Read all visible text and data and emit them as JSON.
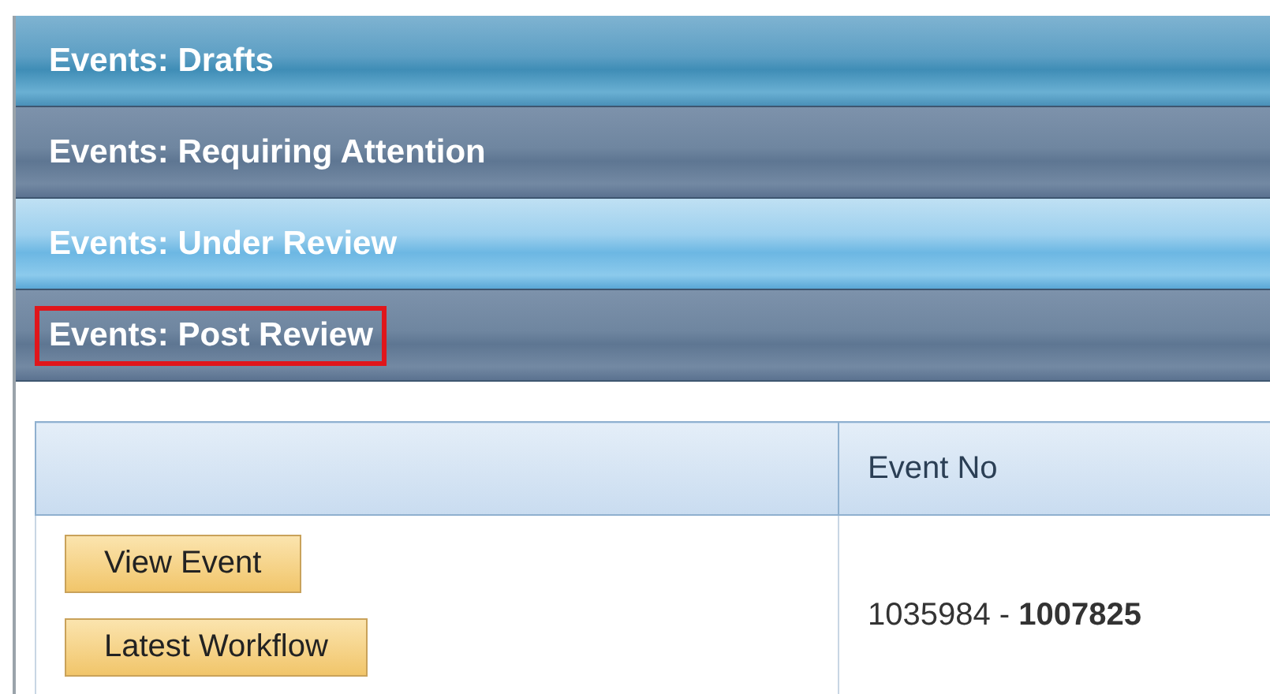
{
  "panels": [
    {
      "title": "Events: Drafts",
      "kind": "blue",
      "highlighted": false
    },
    {
      "title": "Events: Requiring Attention",
      "kind": "slate",
      "highlighted": false
    },
    {
      "title": "Events: Under Review",
      "kind": "light",
      "highlighted": false
    },
    {
      "title": "Events: Post Review",
      "kind": "slate",
      "highlighted": true
    }
  ],
  "table": {
    "columns": [
      "",
      "Event No"
    ],
    "rows": [
      {
        "actions": [
          "View Event",
          "Latest Workflow"
        ],
        "event_no": "1035984 - **1007825**"
      }
    ]
  }
}
